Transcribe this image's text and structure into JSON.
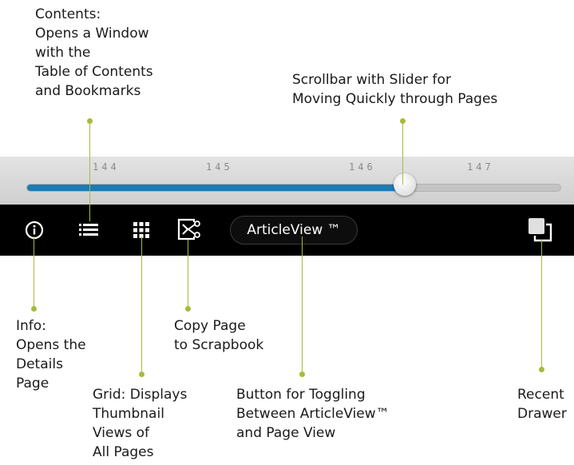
{
  "scrollbar": {
    "page_labels": [
      "144",
      "145",
      "146",
      "147"
    ],
    "position_fraction": 0.71
  },
  "toolbar": {
    "article_view_label": "ArticleView ™",
    "icons": [
      "info-icon",
      "contents-list-icon",
      "grid-icon",
      "copy-to-scrapbook-icon",
      "recent-drawer-icon"
    ]
  },
  "callouts": {
    "contents": [
      "Contents:",
      "Opens a Window",
      "with the",
      "Table of Contents",
      "and Bookmarks"
    ],
    "scrollbar": [
      "Scrollbar with Slider for",
      "Moving Quickly through Pages"
    ],
    "info": [
      "Info:",
      "Opens the",
      "Details",
      "Page"
    ],
    "copy_page": [
      "Copy Page",
      "to Scrapbook"
    ],
    "grid": [
      "Grid: Displays",
      "Thumbnail",
      "Views of",
      "All Pages"
    ],
    "article_toggle": [
      "Button for Toggling",
      "Between ArticleView™",
      "and Page View"
    ],
    "recent_drawer": [
      "Recent",
      "Drawer"
    ]
  },
  "colors": {
    "accent_leader": "#a4bd3a",
    "slider_fill": "#1d7bb5",
    "toolbar_bg": "#000000"
  }
}
